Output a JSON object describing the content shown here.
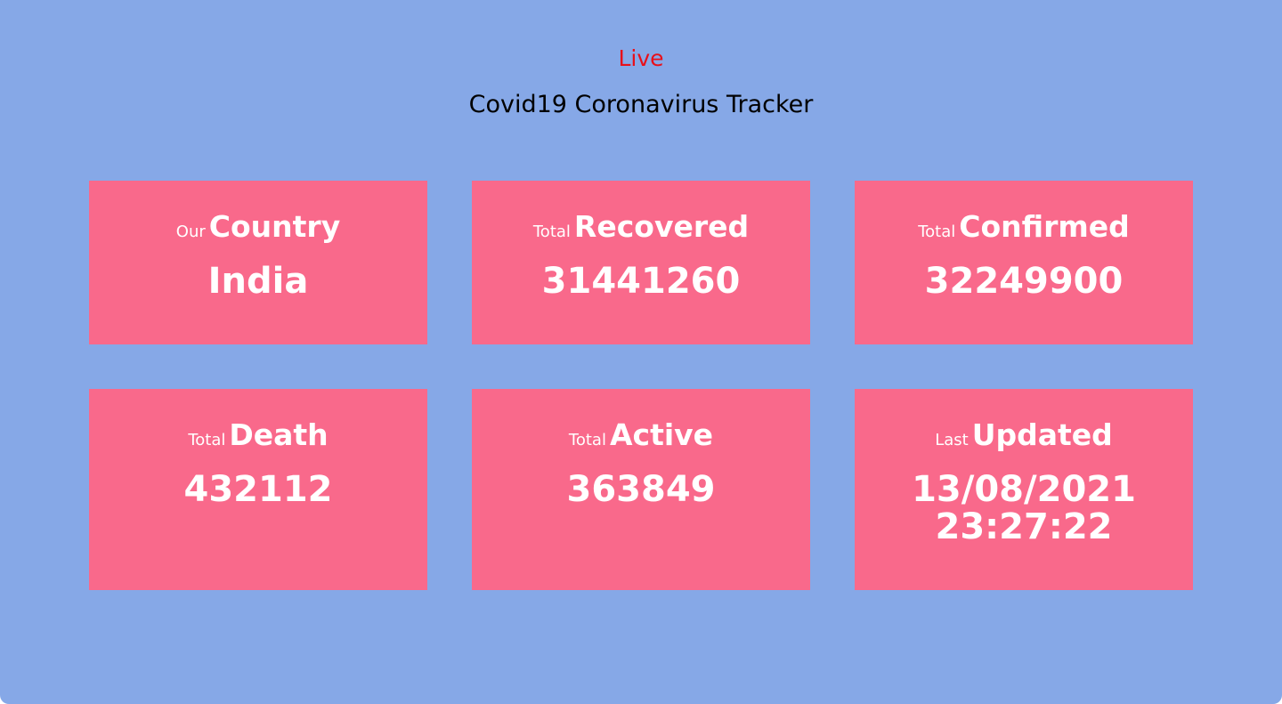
{
  "header": {
    "live_label": "Live",
    "title": "Covid19 Coronavirus Tracker"
  },
  "colors": {
    "background": "#86a8e7",
    "card": "#f9698b",
    "live": "#e8101a"
  },
  "cards": [
    {
      "prefix": "Our",
      "word": "Country",
      "value": "India"
    },
    {
      "prefix": "Total",
      "word": "Recovered",
      "value": "31441260"
    },
    {
      "prefix": "Total",
      "word": "Confirmed",
      "value": "32249900"
    },
    {
      "prefix": "Total",
      "word": "Death",
      "value": "432112"
    },
    {
      "prefix": "Total",
      "word": "Active",
      "value": "363849"
    },
    {
      "prefix": "Last",
      "word": "Updated",
      "value_date": "13/08/2021",
      "value_time": "23:27:22"
    }
  ]
}
